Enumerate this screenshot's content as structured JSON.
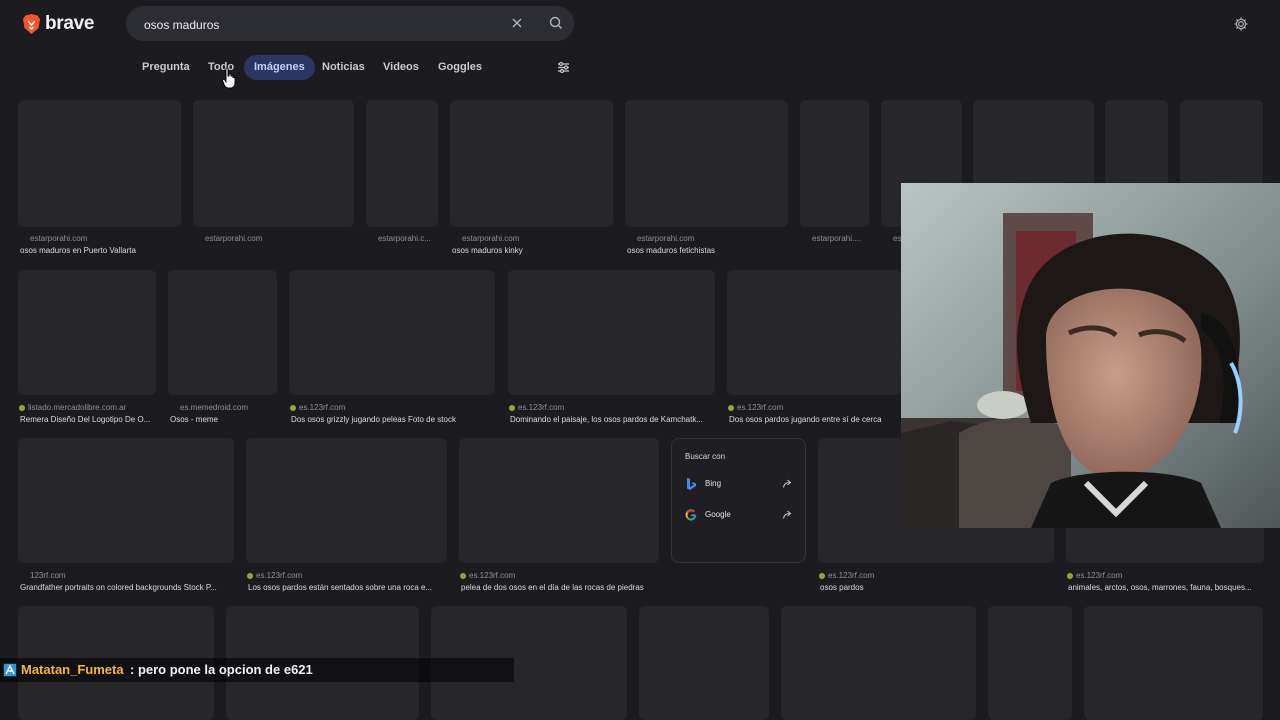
{
  "brand": {
    "name": "brave",
    "accent": "#fb542b"
  },
  "search": {
    "query": "osos maduros",
    "clear_icon": "close-icon",
    "submit_icon": "search-icon"
  },
  "settings_icon": "gear-icon",
  "tabs": [
    {
      "label": "Pregunta",
      "active": false
    },
    {
      "label": "Todo",
      "active": false
    },
    {
      "label": "Imágenes",
      "active": true
    },
    {
      "label": "Noticias",
      "active": false
    },
    {
      "label": "Videos",
      "active": false
    },
    {
      "label": "Goggles",
      "active": false
    }
  ],
  "filter_icon": "sliders-icon",
  "results": [
    {
      "source": "estarporahi.com",
      "title": "osos maduros en Puerto Vallarta"
    },
    {
      "source": "estarporahi.com",
      "title": ""
    },
    {
      "source": "estarporahi.c...",
      "title": ""
    },
    {
      "source": "estarporahi.com",
      "title": "osos maduros kinky"
    },
    {
      "source": "estarporahi.com",
      "title": "osos maduros fetichistas"
    },
    {
      "source": "estarporahi....",
      "title": ""
    },
    {
      "source": "es",
      "title": ""
    },
    {
      "source": "",
      "title": ""
    },
    {
      "source": "",
      "title": ""
    },
    {
      "source": "",
      "title": ""
    },
    {
      "source": "listado.mercadolibre.com.ar",
      "title": "Remera Diseño Del Logotipo De O..."
    },
    {
      "source": "es.memedroid.com",
      "title": "Osos - meme"
    },
    {
      "source": "es.123rf.com",
      "title": "Dos osos grizzly jugando peleas Foto de stock"
    },
    {
      "source": "es.123rf.com",
      "title": "Dominando el paisaje, los osos pardos de Kamchatk..."
    },
    {
      "source": "es.123rf.com",
      "title": "Dos osos pardos jugando entre sí de cerca"
    },
    {
      "source": "123rf.com",
      "title": "Grandfather portraits on colored backgrounds Stock P..."
    },
    {
      "source": "es.123rf.com",
      "title": "Los osos pardos están sentados sobre una roca e..."
    },
    {
      "source": "es.123rf.com",
      "title": "pelea de dos osos en el día de las rocas de piedras"
    },
    {
      "source": "es.123rf.com",
      "title": "osos pardos"
    },
    {
      "source": "es.123rf.com",
      "title": "animales, arctos, osos, marrones, fauna, bosques..."
    },
    {
      "source": "",
      "title": ""
    },
    {
      "source": "",
      "title": ""
    },
    {
      "source": "",
      "title": ""
    },
    {
      "source": "",
      "title": ""
    },
    {
      "source": "",
      "title": ""
    },
    {
      "source": "",
      "title": ""
    },
    {
      "source": "",
      "title": ""
    }
  ],
  "search_with_menu": {
    "title": "Buscar con",
    "items": [
      {
        "label": "Bing",
        "icon": "bing-icon"
      },
      {
        "label": "Google",
        "icon": "google-icon"
      }
    ],
    "open_icon": "share-arrow-icon"
  },
  "chat": {
    "user": "Matatan_Fumeta",
    "message": ": pero pone la opcion de e621",
    "icon": "badge-icon",
    "user_color": "#f4b63d"
  }
}
